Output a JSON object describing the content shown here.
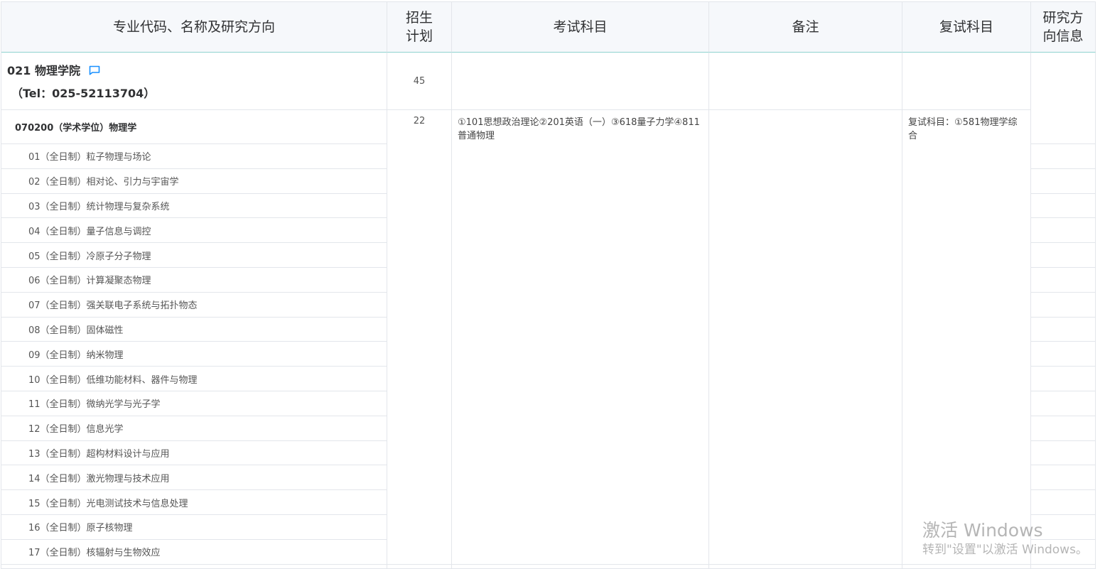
{
  "table": {
    "headers": {
      "major": "专业代码、名称及研究方向",
      "plan": "招生计划",
      "exam": "考试科目",
      "note": "备注",
      "retest": "复试科目",
      "info": "研究方向信息"
    },
    "college": {
      "name": "021 物理学院",
      "tel": "（Tel：025-52113704）",
      "plan": "45",
      "icon": "message-icon"
    },
    "major": {
      "name": "070200（学术学位）物理学",
      "plan": "22",
      "exam": "①101思想政治理论②201英语（一）③618量子力学④811普通物理",
      "retest": "复试科目：①581物理学综合"
    },
    "directions": [
      "01（全日制）粒子物理与场论",
      "02（全日制）相对论、引力与宇宙学",
      "03（全日制）统计物理与复杂系统",
      "04（全日制）量子信息与调控",
      "05（全日制）冷原子分子物理",
      "06（全日制）计算凝聚态物理",
      "07（全日制）强关联电子系统与拓扑物态",
      "08（全日制）固体磁性",
      "09（全日制）纳米物理",
      "10（全日制）低维功能材料、器件与物理",
      "11（全日制）微纳光学与光子学",
      "12（全日制）信息光学",
      "13（全日制）超构材料设计与应用",
      "14（全日制）激光物理与技术应用",
      "15（全日制）光电测试技术与信息处理",
      "16（全日制）原子核物理",
      "17（全日制）核辐射与生物效应"
    ]
  },
  "watermark": {
    "line1": "激活 Windows",
    "line2": "转到\"设置\"以激活 Windows。"
  },
  "colors": {
    "accent": "#1890ff",
    "header_bg": "#f6f8fb",
    "header_border": "#8fd3cf",
    "grid_line": "#e3e6eb"
  }
}
